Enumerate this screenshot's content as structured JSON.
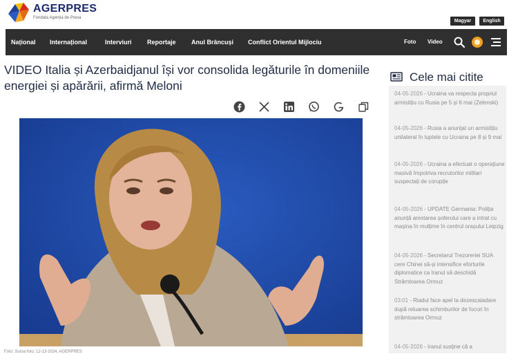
{
  "brand": {
    "name": "AGERPRES",
    "tagline": "Fondata Agenția de Presa"
  },
  "languages": [
    {
      "label": "Magyar"
    },
    {
      "label": "English"
    }
  ],
  "nav": {
    "items": [
      "Național",
      "Internațional",
      "Interviuri",
      "Reportaje",
      "Anul Brâncuși",
      "Conflict Orientul Mijlociu"
    ],
    "right": {
      "foto": "Foto",
      "video": "Video"
    },
    "icons": [
      "search-icon",
      "weather-icon",
      "menu-icon"
    ]
  },
  "article": {
    "headline": "VIDEO Italia și Azerbaidjanul își vor consolida legăturile în domeniile energiei și apărării, afirmă Meloni",
    "share_icons": [
      "facebook-icon",
      "x-icon",
      "linkedin-icon",
      "whatsapp-icon",
      "google-icon",
      "copy-icon"
    ],
    "caption": "Foto: Sursa foto: 12-13 2024, AGERPRES"
  },
  "sidebar": {
    "title": "Cele mai citite",
    "items": [
      {
        "time": "04-05-2026",
        "text": "Ucraina va respecta propriul armistițiu cu Rusia pe 5 și 6 mai (Zelenski)"
      },
      {
        "time": "04-05-2026",
        "text": "Rusia a anunțat un armistițiu unilateral în luptele cu Ucraina pe 8 și 9 mai"
      },
      {
        "time": "04-05-2026",
        "text": "Ucraina a efectuat o operațiune masivă împotriva recrutorilor militari suspectați de corupție"
      },
      {
        "time": "04-05-2026",
        "text": "UPDATE Germania: Poliția anunță arestarea șoferului care a intrat cu mașina în mulțime în centrul orașului Leipzig"
      },
      {
        "time": "04-05-2026",
        "text": "Secretarul Trezoreriei SUA cere Chinei să-și intensifice eforturile diplomatice ca Iranul să deschidă Strâmtoarea Ormuz"
      },
      {
        "time": "03:01",
        "text": "Riadul face apel la dezescaladare după reluarea schimburilor de focuri în strâmtoarea Ormuz"
      },
      {
        "time": "04-05-2026",
        "text": "Iranul susține că a"
      }
    ]
  },
  "colors": {
    "nav_bg": "#2f2f2f",
    "headline": "#1f2b44",
    "sidebar_bg": "#f1f1f1",
    "brand_blue": "#1a2a6c"
  }
}
